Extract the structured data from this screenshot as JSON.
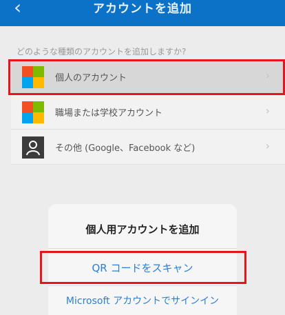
{
  "nav": {
    "back_glyph": "‹",
    "title": "アカウントを追加"
  },
  "section_header": "どのような種類のアカウントを追加しますか?",
  "accounts": [
    {
      "label": "個人のアカウント",
      "icon": "microsoft-logo-icon",
      "selected": true
    },
    {
      "label": "職場または学校アカウント",
      "icon": "microsoft-logo-icon",
      "selected": false
    },
    {
      "label": "その他 (Google、Facebook など)",
      "icon": "person-icon",
      "selected": false
    }
  ],
  "chevron_glyph": "›",
  "sheet": {
    "title": "個人用アカウントを追加",
    "actions": [
      "QR コードをスキャン",
      "Microsoft アカウントでサインイン"
    ]
  },
  "colors": {
    "nav_blue": "#0b72c7",
    "highlight_red": "#e8141b",
    "action_blue": "#2b7fd6",
    "ms_red": "#f25022",
    "ms_green": "#7fba00",
    "ms_blue": "#00a4ef",
    "ms_yellow": "#ffb900"
  }
}
